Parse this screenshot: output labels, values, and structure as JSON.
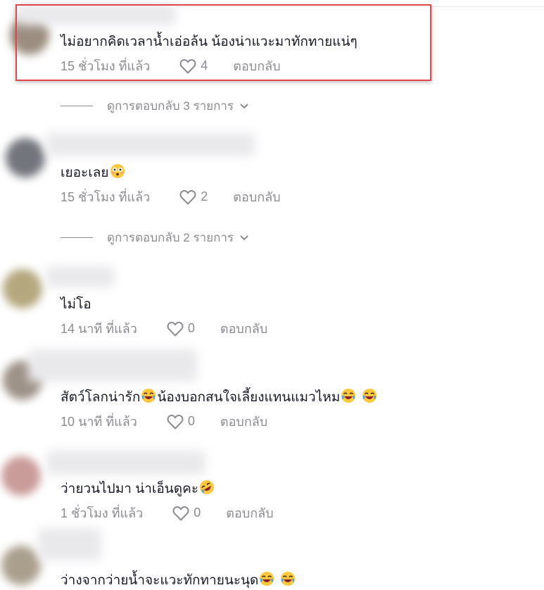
{
  "comments": [
    {
      "text": "ไม่อยากคิดเวลาน้ำเอ่อล้น น้องน่าแวะมาทักทายแน่ๆ",
      "time": "15 ชั่วโมง ที่แล้ว",
      "likes": "4",
      "reply": "ตอบกลับ"
    },
    {
      "text": "เยอะเลย",
      "emoji": "flushed-face",
      "time": "15 ชั่วโมง ที่แล้ว",
      "likes": "2",
      "reply": "ตอบกลับ"
    },
    {
      "text": "ไม่โอ",
      "time": "14 นาที ที่แล้ว",
      "likes": "0",
      "reply": "ตอบกลับ"
    },
    {
      "text_a": "สัตว์โลกน่ารัก",
      "text_b": "น้องบอกสนใจเลี้ยงแทนแมวไหม",
      "emoji": "laughing-face",
      "time": "10 นาที ที่แล้ว",
      "likes": "0",
      "reply": "ตอบกลับ"
    },
    {
      "text": "ว่ายวนไปมา น่าเอ็นดูคะ",
      "emoji": "rofl-face",
      "time": "1 ชั่วโมง ที่แล้ว",
      "likes": "0",
      "reply": "ตอบกลับ"
    },
    {
      "text": "ว่างจากว่ายน้ำจะแวะทักทายนะนุด",
      "emoji": "laughing-face"
    }
  ],
  "view_replies": [
    {
      "label": "ดูการตอบกลับ 3 รายการ"
    },
    {
      "label": "ดูการตอบกลับ 2 รายการ"
    }
  ],
  "colors": {
    "highlight": "#e3474c",
    "meta": "#8a8b91",
    "text": "#161823"
  }
}
